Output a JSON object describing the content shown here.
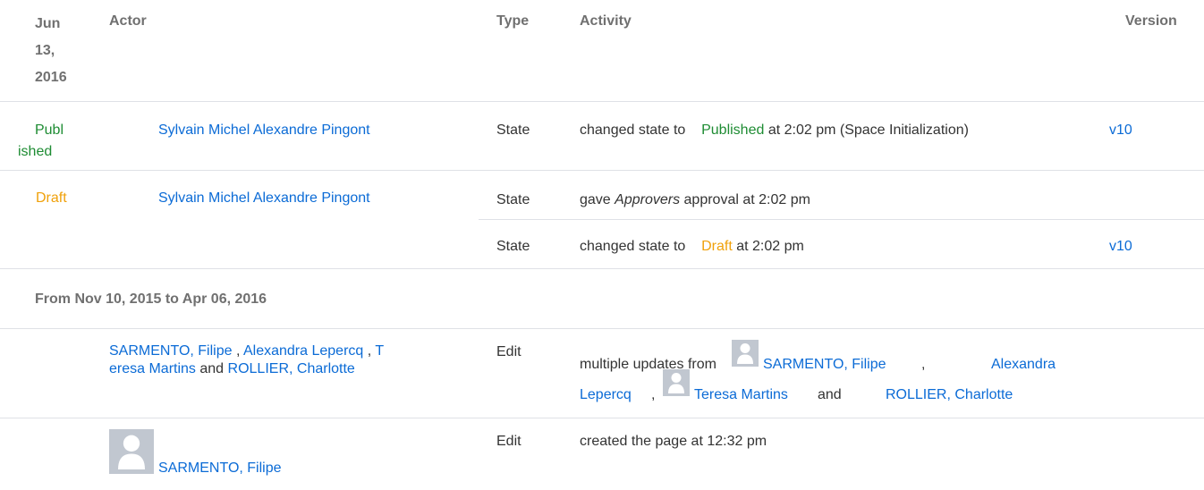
{
  "header": {
    "date_line1": "Jun",
    "date_line2": "13,",
    "date_line3": "2016",
    "actor": "Actor",
    "type": "Type",
    "activity": "Activity",
    "version": "Version"
  },
  "row_published": {
    "status_line1": "Publ",
    "status_line2": "ished",
    "actor": "Sylvain Michel Alexandre Pingont",
    "type": "State",
    "activity_prefix": "changed state to",
    "activity_state": "Published",
    "activity_suffix": "at 2:02 pm (Space Initialization)",
    "version": "v10"
  },
  "row_draft": {
    "status": "Draft",
    "actor": "Sylvain Michel Alexandre Pingont",
    "sub1_type": "State",
    "sub1_activity_prefix": "gave",
    "sub1_activity_group": "Approvers",
    "sub1_activity_suffix": "approval at 2:02 pm",
    "sub2_type": "State",
    "sub2_activity_prefix": "changed state to",
    "sub2_activity_state": "Draft",
    "sub2_activity_suffix": "at 2:02 pm",
    "sub2_version": "v10"
  },
  "range_header": "From Nov 10, 2015 to Apr 06, 2016",
  "row_multi": {
    "actor1": "SARMENTO, Filipe",
    "sep1": ",",
    "actor2": "Alexandra Lepercq",
    "sep2": ",",
    "actor3_part1": "T",
    "actor3_part2": "eresa Martins",
    "and": "and",
    "actor4": "ROLLIER, Charlotte",
    "type": "Edit",
    "activity_prefix": "multiple updates from",
    "act_user1": "SARMENTO, Filipe",
    "act_sep1": ",",
    "act_user2_part1": "Alexandra",
    "act_user2_part2": "Lepercq",
    "act_sep2": ",",
    "act_user3": "Teresa Martins",
    "act_and": "and",
    "act_user4": "ROLLIER, Charlotte"
  },
  "row_created": {
    "actor": "SARMENTO, Filipe",
    "type": "Edit",
    "activity": "created the page at 12:32 pm"
  },
  "colors": {
    "link": "#0b6bd6",
    "published": "#1e8c33",
    "draft": "#f0a10b",
    "header_text": "#707070",
    "divider": "#dfe1e6",
    "avatar": "#c1c7d0"
  },
  "icons": [
    "user-avatar-icon"
  ]
}
